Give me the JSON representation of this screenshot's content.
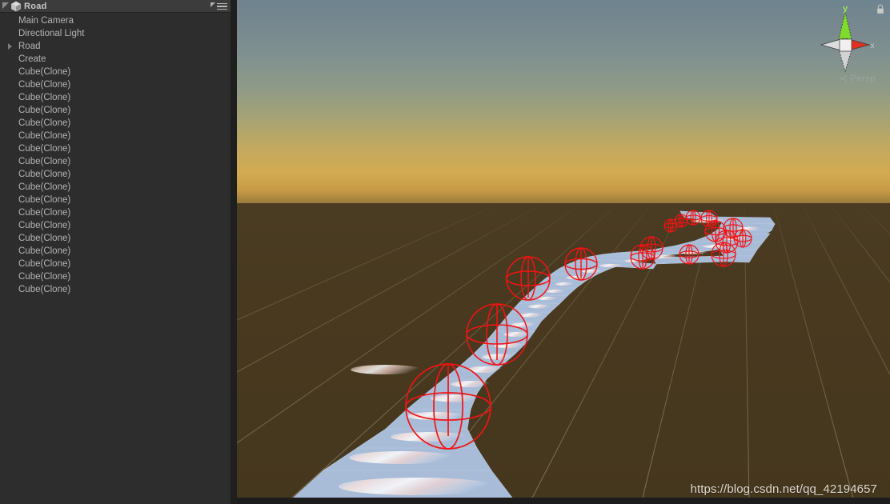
{
  "hierarchy": {
    "title": "Road",
    "scene_icon": "unity-scene-icon",
    "menu_icon": "hamburger-menu-icon",
    "filter_icon": "filter-triangle-icon",
    "panel_bg": "#2d2d2d",
    "header_bg": "#3c3c3c",
    "text_color": "#b4b4b4",
    "items": [
      {
        "label": "Main Camera",
        "expandable": false
      },
      {
        "label": "Directional Light",
        "expandable": false
      },
      {
        "label": "Road",
        "expandable": true
      },
      {
        "label": "Create",
        "expandable": false
      },
      {
        "label": "Cube(Clone)",
        "expandable": false
      },
      {
        "label": "Cube(Clone)",
        "expandable": false
      },
      {
        "label": "Cube(Clone)",
        "expandable": false
      },
      {
        "label": "Cube(Clone)",
        "expandable": false
      },
      {
        "label": "Cube(Clone)",
        "expandable": false
      },
      {
        "label": "Cube(Clone)",
        "expandable": false
      },
      {
        "label": "Cube(Clone)",
        "expandable": false
      },
      {
        "label": "Cube(Clone)",
        "expandable": false
      },
      {
        "label": "Cube(Clone)",
        "expandable": false
      },
      {
        "label": "Cube(Clone)",
        "expandable": false
      },
      {
        "label": "Cube(Clone)",
        "expandable": false
      },
      {
        "label": "Cube(Clone)",
        "expandable": false
      },
      {
        "label": "Cube(Clone)",
        "expandable": false
      },
      {
        "label": "Cube(Clone)",
        "expandable": false
      },
      {
        "label": "Cube(Clone)",
        "expandable": false
      },
      {
        "label": "Cube(Clone)",
        "expandable": false
      },
      {
        "label": "Cube(Clone)",
        "expandable": false
      },
      {
        "label": "Cube(Clone)",
        "expandable": false
      }
    ]
  },
  "scene": {
    "projection_label": "Persp",
    "projection_arrow": "≺",
    "lock_icon": "lock-icon",
    "gizmo": {
      "axis_y_label": "y",
      "axis_x_label": "x",
      "axis_y_color": "#7ddd2a",
      "axis_x_color": "#e03020",
      "axis_neutral_color": "#d8d8d8"
    },
    "colors": {
      "sky_top": "#6f8390",
      "sky_mid": "#8d9a88",
      "sky_horizon": "#d2ab51",
      "ground": "#48391f",
      "grid_line": "#6d6049",
      "road_surface": "#a8bcd8",
      "gizmo_wire": "#f21313"
    },
    "watermark": "https://blog.csdn.net/qq_42194657"
  }
}
